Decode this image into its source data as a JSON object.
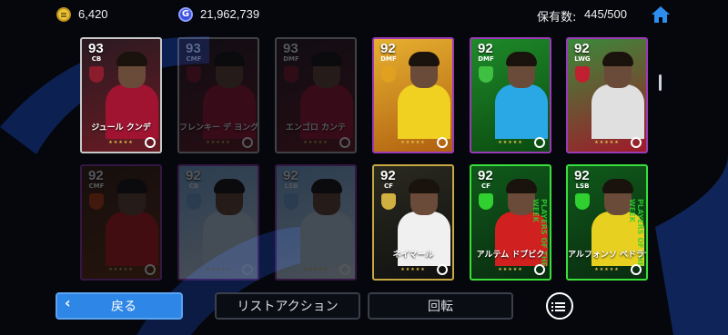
{
  "currency": {
    "gp_icon": "gp-coin-icon",
    "gp_amount": "6,420",
    "coin_icon": "efootball-coin-icon",
    "coin_letter": "G",
    "coin_amount": "21,962,739"
  },
  "ownership": {
    "label": "保有数:",
    "value": "445/500"
  },
  "home_icon": "home-icon",
  "cards": [
    {
      "ovr": "93",
      "pos": "CB",
      "name": "ジュール クンデ",
      "dim": false,
      "accent": "#8b1c2c",
      "bg1": "#2a1a22",
      "bg2": "#6a1a22",
      "border": "#c8c8c8",
      "shirt": "#a01432",
      "side": ""
    },
    {
      "ovr": "93",
      "pos": "CMF",
      "name": "フレンキー デ ヨング",
      "dim": true,
      "accent": "#8b1c2c",
      "bg1": "#2a1a22",
      "bg2": "#6a1a22",
      "border": "#bdbdbd",
      "shirt": "#a01432",
      "side": ""
    },
    {
      "ovr": "93",
      "pos": "DMF",
      "name": "エンゴロ カンテ",
      "dim": true,
      "accent": "#8b1c2c",
      "bg1": "#2a1a22",
      "bg2": "#6a1a22",
      "border": "#bdbdbd",
      "shirt": "#a01432",
      "side": ""
    },
    {
      "ovr": "92",
      "pos": "DMF",
      "name": "",
      "dim": false,
      "accent": "#e0a020",
      "bg1": "#e6b030",
      "bg2": "#b06010",
      "border": "#9b3ab8",
      "shirt": "#f0d020",
      "side": ""
    },
    {
      "ovr": "92",
      "pos": "DMF",
      "name": "",
      "dim": false,
      "accent": "#40c040",
      "bg1": "#1f8a2a",
      "bg2": "#0a4a10",
      "border": "#9b3ab8",
      "shirt": "#2aa8e6",
      "side": ""
    },
    {
      "ovr": "92",
      "pos": "LWG",
      "name": "",
      "dim": false,
      "accent": "#c02030",
      "bg1": "#3a8a3a",
      "bg2": "#a01a2a",
      "border": "#9b3ab8",
      "shirt": "#e0e0e0",
      "side": ""
    },
    {
      "ovr": "92",
      "pos": "CMF",
      "name": "",
      "dim": true,
      "accent": "#c04010",
      "bg1": "#3a2010",
      "bg2": "#6a3010",
      "border": "#9b3ab8",
      "shirt": "#c01a1a",
      "side": ""
    },
    {
      "ovr": "92",
      "pos": "CB",
      "name": "",
      "dim": true,
      "accent": "#7ab0e0",
      "bg1": "#7ab0e0",
      "bg2": "#dde8f4",
      "border": "#9b3ab8",
      "shirt": "#c8dcf0",
      "side": ""
    },
    {
      "ovr": "92",
      "pos": "LSB",
      "name": "",
      "dim": true,
      "accent": "#7ab0e0",
      "bg1": "#7ab0e0",
      "bg2": "#dde8f4",
      "border": "#9b3ab8",
      "shirt": "#c8dcf0",
      "side": ""
    },
    {
      "ovr": "92",
      "pos": "CF",
      "name": "ネイマール",
      "dim": false,
      "accent": "#d0b040",
      "bg1": "#2a2a20",
      "bg2": "#101010",
      "border": "#c8a840",
      "shirt": "#f0f0f0",
      "side": ""
    },
    {
      "ovr": "92",
      "pos": "CF",
      "name": "アルテム ドブビク",
      "dim": false,
      "accent": "#30d030",
      "bg1": "#0f5a1a",
      "bg2": "#0a2a10",
      "border": "#3ae03a",
      "shirt": "#d02020",
      "side": "PLAYERS OF THE WEEK"
    },
    {
      "ovr": "92",
      "pos": "LSB",
      "name": "アルフォンソ ペドラサ",
      "dim": false,
      "accent": "#30d030",
      "bg1": "#0f5a1a",
      "bg2": "#0a2a10",
      "border": "#3ae03a",
      "shirt": "#e8d020",
      "side": "PLAYERS OF THE WEEK"
    }
  ],
  "card_icons": {
    "stars": "★★★★★",
    "logo": "efootball-logo-icon"
  },
  "bottom": {
    "back_label": "戻る",
    "back_chevron": "‹",
    "list_action_label": "リストアクション",
    "rotation_label": "回転",
    "menu_icon": "list-menu-icon"
  }
}
